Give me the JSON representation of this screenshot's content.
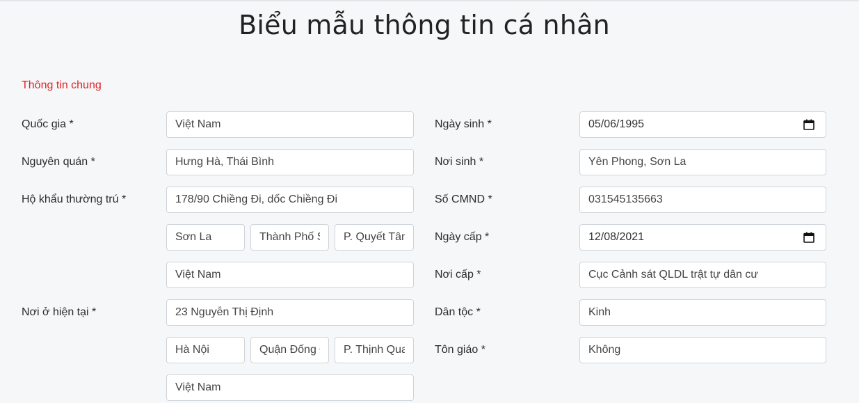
{
  "page": {
    "title": "Biểu mẫu thông tin cá nhân",
    "section": "Thông tin chung"
  },
  "left": {
    "quoc_gia": {
      "label": "Quốc gia *",
      "value": "Việt Nam"
    },
    "nguyen_quan": {
      "label": "Nguyên quán *",
      "value": "Hưng Hà, Thái Bình"
    },
    "ho_khau": {
      "label": "Hộ khẩu thường trú *",
      "address": "178/90 Chiềng Đi, dốc Chiềng Đi",
      "province": "Sơn La",
      "district": "Thành Phố Sơn La",
      "ward": "P. Quyết Tâm",
      "country": "Việt Nam"
    },
    "noi_o": {
      "label": "Nơi ở hiện tại *",
      "address": "23 Nguyễn Thị Định",
      "province": "Hà Nội",
      "district": "Quận Đống Đa",
      "ward": "P. Thịnh Quang",
      "country": "Việt Nam"
    }
  },
  "right": {
    "ngay_sinh": {
      "label": "Ngày sinh *",
      "value": "05/06/1995"
    },
    "noi_sinh": {
      "label": "Nơi sinh *",
      "value": "Yên Phong, Sơn La"
    },
    "so_cmnd": {
      "label": "Số CMND *",
      "value": "031545135663"
    },
    "ngay_cap": {
      "label": "Ngày cấp *",
      "value": "12/08/2021"
    },
    "noi_cap": {
      "label": "Nơi cấp *",
      "value": "Cục Cảnh sát QLDL trật tự dân cư"
    },
    "dan_toc": {
      "label": "Dân tộc *",
      "value": "Kinh"
    },
    "ton_giao": {
      "label": "Tôn giáo *",
      "value": "Không"
    }
  },
  "icons": {
    "calendar": "calendar-icon"
  },
  "colors": {
    "section_label": "#e02424",
    "background": "#f6f7f9",
    "input_border": "#cfd4da"
  }
}
